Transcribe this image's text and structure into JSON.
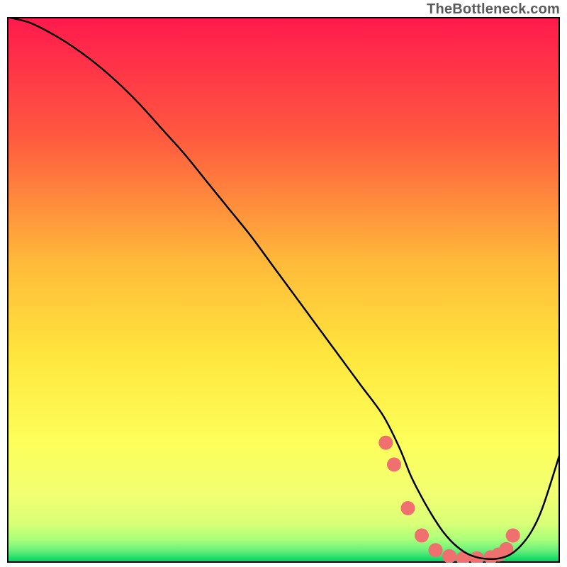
{
  "watermark": "TheBottleneck.com",
  "chart_data": {
    "type": "line",
    "title": "",
    "xlabel": "",
    "ylabel": "",
    "xlim": [
      0,
      100
    ],
    "ylim": [
      0,
      100
    ],
    "background_gradient": {
      "top": "#ff1a4d",
      "upper_mid": "#ff8a3d",
      "mid": "#ffe23d",
      "lower_mid": "#f4ff66",
      "bottom": "#00d463"
    },
    "series": [
      {
        "name": "bottleneck-curve",
        "stroke": "#000000",
        "x": [
          0,
          4,
          8,
          12,
          16,
          20,
          24,
          28,
          32,
          36,
          40,
          44,
          48,
          52,
          56,
          60,
          64,
          68,
          71,
          73,
          75,
          77,
          79,
          81,
          83,
          85,
          87,
          89,
          91,
          93,
          95,
          97,
          100
        ],
        "y": [
          100,
          99,
          97,
          94.5,
          91.5,
          88,
          84,
          79.5,
          75,
          70,
          65,
          60,
          54.5,
          49,
          43.5,
          38,
          32.5,
          27,
          21,
          16,
          12,
          8.5,
          5.5,
          3.3,
          1.8,
          1.0,
          0.7,
          0.8,
          1.5,
          3.2,
          6.0,
          10.5,
          20
        ]
      }
    ],
    "markers": {
      "name": "segment-dots",
      "color": "#f07070",
      "radius": 10,
      "x": [
        68.5,
        70.0,
        72.5,
        75.0,
        77.5,
        80.0,
        82.5,
        85.0,
        87.5,
        88.9,
        90.3,
        91.5
      ],
      "y": [
        22.0,
        18.0,
        10.0,
        5.0,
        2.3,
        1.2,
        0.8,
        0.8,
        1.0,
        1.5,
        2.5,
        5.0
      ]
    }
  }
}
